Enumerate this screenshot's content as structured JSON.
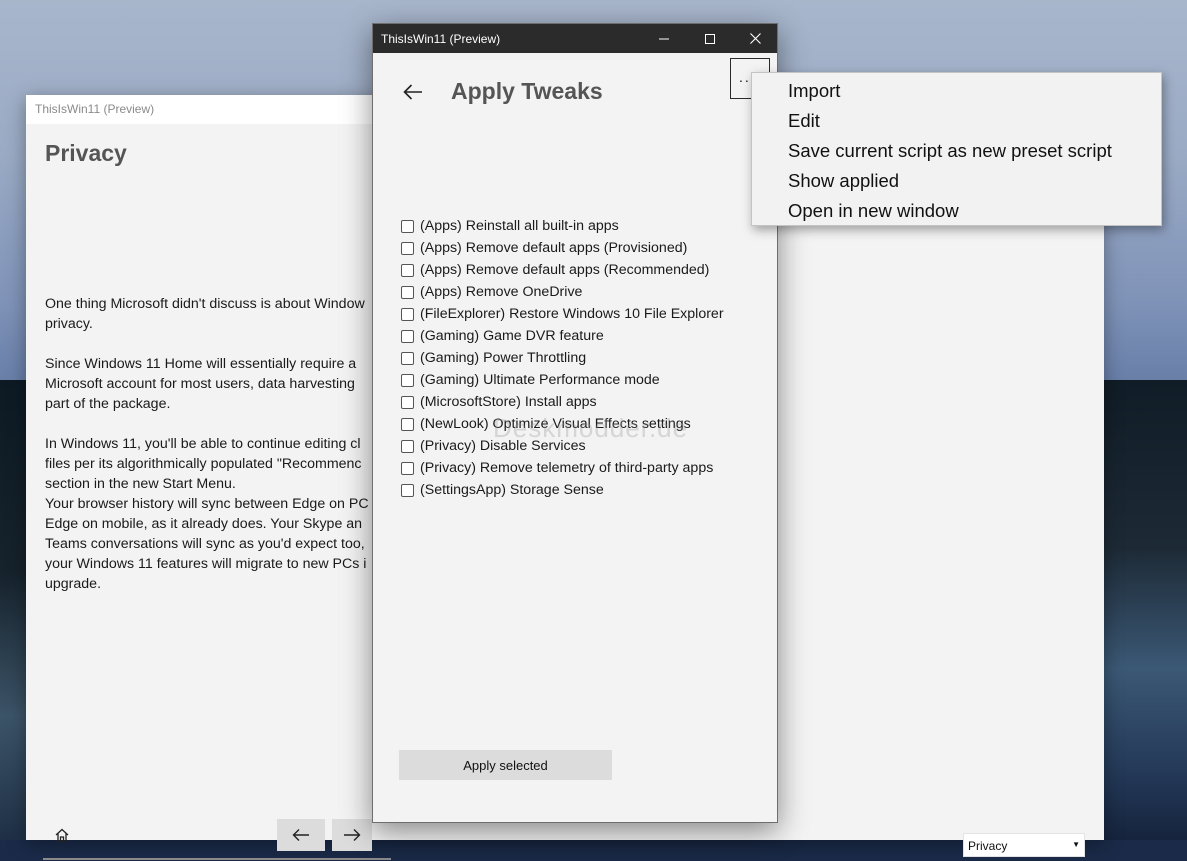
{
  "background_colors": {
    "sky": "#9aaac4",
    "water": "#2a3e6c"
  },
  "back_window": {
    "title": "ThisIsWin11 (Preview)",
    "heading": "Privacy",
    "body_text": "One thing Microsoft didn't discuss is about Window\nprivacy.\n\nSince Windows 11 Home will essentially require a\nMicrosoft account for most users, data harvesting\npart of the package.\n\nIn Windows 11, you'll be able to continue editing cl\nfiles per its algorithmically populated \"Recommenc\nsection in the new Start Menu.\nYour browser history will sync between Edge on PC\nEdge on mobile, as it already does. Your Skype an\nTeams conversations will sync as you'd expect too,\nyour Windows 11 features will migrate to new PCs i\nupgrade.",
    "home_icon": "home-icon",
    "nav_back_icon": "arrow-left-icon",
    "nav_forward_icon": "arrow-right-icon",
    "dropdown_selected": "Privacy"
  },
  "front_window": {
    "title": "ThisIsWin11 (Preview)",
    "heading": "Apply Tweaks",
    "more_label": "...",
    "tweaks": [
      {
        "label": "(Apps) Reinstall all built-in apps",
        "checked": false
      },
      {
        "label": "(Apps) Remove default apps (Provisioned)",
        "checked": false
      },
      {
        "label": "(Apps) Remove default apps (Recommended)",
        "checked": false
      },
      {
        "label": "(Apps) Remove OneDrive",
        "checked": false
      },
      {
        "label": "(FileExplorer) Restore Windows 10 File Explorer",
        "checked": false
      },
      {
        "label": "(Gaming) Game DVR feature",
        "checked": false
      },
      {
        "label": "(Gaming) Power Throttling",
        "checked": false
      },
      {
        "label": "(Gaming) Ultimate Performance mode",
        "checked": false
      },
      {
        "label": "(MicrosoftStore) Install apps",
        "checked": false
      },
      {
        "label": "(NewLook) Optimize Visual Effects settings",
        "checked": false
      },
      {
        "label": "(Privacy) Disable Services",
        "checked": false
      },
      {
        "label": "(Privacy) Remove telemetry of third-party apps",
        "checked": false
      },
      {
        "label": "(SettingsApp) Storage Sense",
        "checked": false
      }
    ],
    "watermark": "Deskmodder.de",
    "apply_button": "Apply selected"
  },
  "context_menu": {
    "items": [
      "Import",
      "Edit",
      "Save current script as new preset script",
      "Show applied",
      "Open in new window"
    ]
  }
}
